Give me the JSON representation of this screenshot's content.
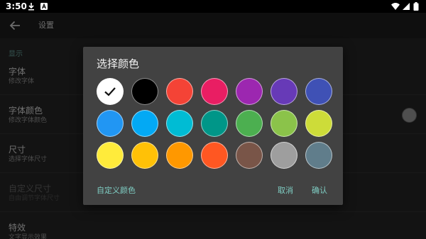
{
  "status_bar": {
    "time": "3:50",
    "icons": [
      "download-icon",
      "a-notification-icon",
      "wifi-icon",
      "signal-icon",
      "battery-icon"
    ]
  },
  "app_bar": {
    "title": "设置",
    "back_icon": "arrow-left-icon"
  },
  "settings": {
    "category": "显示",
    "items": [
      {
        "title": "字体",
        "subtitle": "修改字体",
        "enabled": true
      },
      {
        "title": "字体颜色",
        "subtitle": "修改字体颜色",
        "enabled": true
      },
      {
        "title": "尺寸",
        "subtitle": "选择字体尺寸",
        "enabled": true
      },
      {
        "title": "自定义尺寸",
        "subtitle": "自由调节字体尺寸",
        "enabled": false
      },
      {
        "title": "特效",
        "subtitle": "文字显示效果",
        "enabled": true
      }
    ],
    "current_color": "#9e9e9e"
  },
  "dialog": {
    "title": "选择颜色",
    "selected_index": 0,
    "colors": [
      "#ffffff",
      "#000000",
      "#f44336",
      "#e91e63",
      "#9c27b0",
      "#673ab7",
      "#3f51b5",
      "#2196f3",
      "#03a9f4",
      "#00bcd4",
      "#009688",
      "#4caf50",
      "#8bc34a",
      "#cddc39",
      "#ffeb3b",
      "#ffc107",
      "#ff9800",
      "#ff5722",
      "#795548",
      "#9e9e9e",
      "#607d8b"
    ],
    "custom_label": "自定义颜色",
    "cancel_label": "取消",
    "ok_label": "确认",
    "accent": "#7fcdc3"
  }
}
